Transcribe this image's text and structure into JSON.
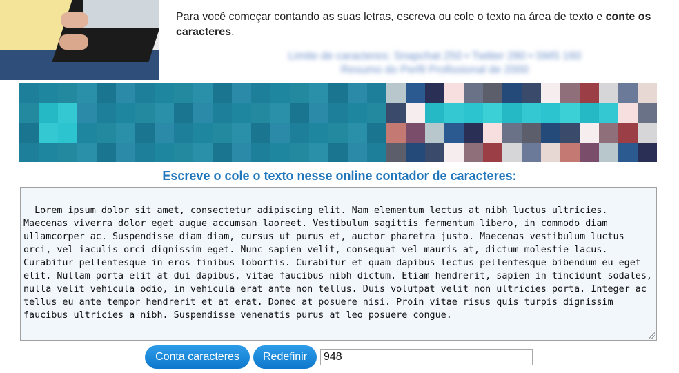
{
  "intro": {
    "text": "Para você começar contando as suas letras, escreva ou cole o texto na área de texto e ",
    "bold": "conte os caracteres",
    "end": "."
  },
  "blurred": {
    "line1": "Limite de caracteres: Snapchat 250 • Twitter 280 • SMS 160",
    "line2": "Resumo do Perfil Profissional de 2000"
  },
  "heading": "Escreve o cole o texto nesse online contador de caracteres:",
  "textarea": {
    "value": "Lorem ipsum dolor sit amet, consectetur adipiscing elit. Nam elementum lectus at nibh luctus ultricies. Maecenas viverra dolor eget augue accumsan laoreet. Vestibulum sagittis fermentum libero, in commodo diam ullamcorper ac. Suspendisse diam diam, cursus ut purus et, auctor pharetra justo. Maecenas vestibulum luctus orci, vel iaculis orci dignissim eget. Nunc sapien velit, consequat vel mauris at, dictum molestie lacus. Curabitur pellentesque in eros finibus lobortis. Curabitur et quam dapibus lectus pellentesque bibendum eu eget elit. Nullam porta elit at dui dapibus, vitae faucibus nibh dictum. Etiam hendrerit, sapien in tincidunt sodales, nulla velit vehicula odio, in vehicula erat ante non tellus. Duis volutpat velit non ultricies porta. Integer ac tellus eu ante tempor hendrerit et at erat. Donec at posuere nisi. Proin vitae risus quis turpis dignissim faucibus ultricies a nibh. Suspendisse venenatis purus at leo posuere congue."
  },
  "buttons": {
    "count": "Conta caracteres",
    "reset": "Redefinir"
  },
  "result": {
    "value": "948"
  },
  "colors": {
    "heading": "#2277bb",
    "button": "#1a88d8",
    "textarea_bg": "#f2f7fc"
  }
}
